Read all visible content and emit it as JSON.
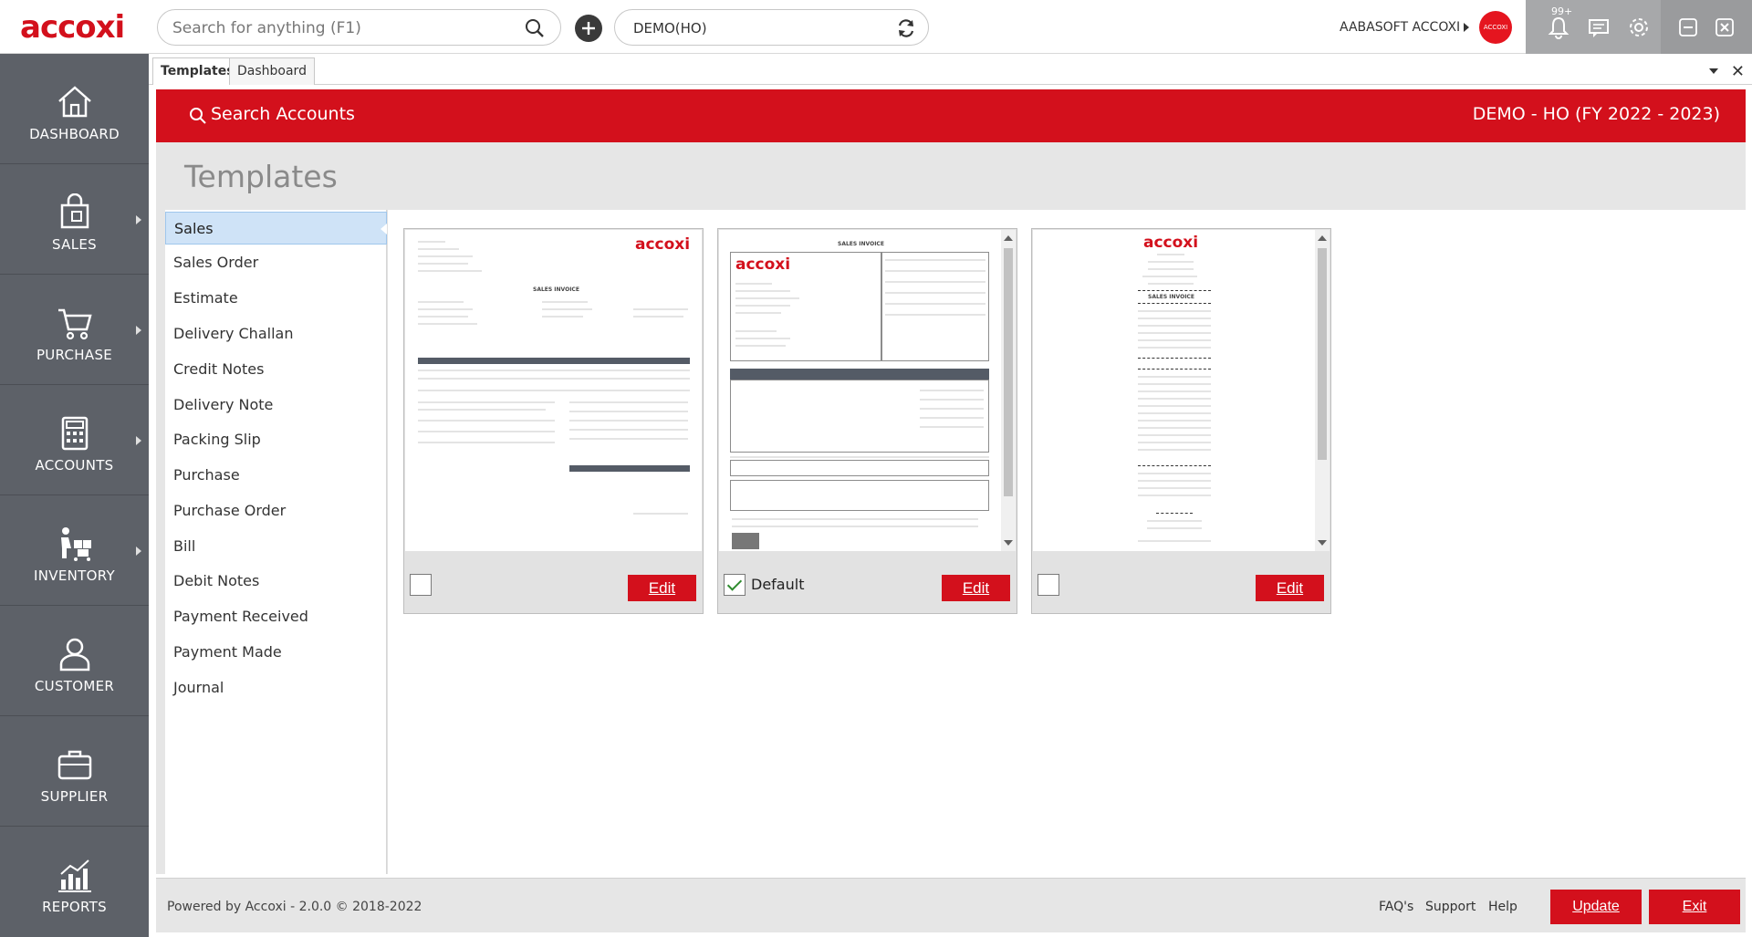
{
  "app": {
    "logo": "accoxi"
  },
  "search": {
    "placeholder": "Search for anything (F1)"
  },
  "company_selector": {
    "value": "DEMO(HO)"
  },
  "user": {
    "name": "AABASOFT ACCOXI",
    "avatar_text": "ACCOXI"
  },
  "notifications": {
    "badge": "99+"
  },
  "sidebar": {
    "items": [
      {
        "label": "DASHBOARD",
        "icon": "home-icon",
        "submenu": false
      },
      {
        "label": "SALES",
        "icon": "shopping-bag-icon",
        "submenu": true
      },
      {
        "label": "PURCHASE",
        "icon": "cart-icon",
        "submenu": true
      },
      {
        "label": "ACCOUNTS",
        "icon": "calculator-icon",
        "submenu": true
      },
      {
        "label": "INVENTORY",
        "icon": "inventory-icon",
        "submenu": true
      },
      {
        "label": "CUSTOMER",
        "icon": "user-icon",
        "submenu": false
      },
      {
        "label": "SUPPLIER",
        "icon": "briefcase-icon",
        "submenu": false
      },
      {
        "label": "REPORTS",
        "icon": "bar-chart-icon",
        "submenu": false
      }
    ]
  },
  "tabs": [
    {
      "label": "Templates",
      "active": true
    },
    {
      "label": "Dashboard",
      "active": false
    }
  ],
  "header": {
    "search_accounts": "Search Accounts",
    "company_title": "DEMO - HO (FY 2022 - 2023)"
  },
  "page": {
    "title": "Templates"
  },
  "template_types": [
    "Sales",
    "Sales Order",
    "Estimate",
    "Delivery Challan",
    "Credit Notes",
    "Delivery Note",
    "Packing Slip",
    "Purchase",
    "Purchase Order",
    "Bill",
    "Debit Notes",
    "Payment Received",
    "Payment Made",
    "Journal"
  ],
  "selected_type": "Sales",
  "cards": [
    {
      "default": false,
      "default_label": "",
      "edit_label": "Edit",
      "preview": {
        "logo": "accoxi",
        "title": "SALES INVOICE"
      }
    },
    {
      "default": true,
      "default_label": "Default",
      "edit_label": "Edit",
      "preview": {
        "logo": "accoxi",
        "title": "SALES INVOICE"
      }
    },
    {
      "default": false,
      "default_label": "",
      "edit_label": "Edit",
      "preview": {
        "logo": "accoxi",
        "title": "SALES INVOICE"
      }
    }
  ],
  "footer": {
    "powered_by": "Powered by Accoxi - 2.0.0 © 2018-2022",
    "links": [
      "FAQ's",
      "Support",
      "Help"
    ],
    "update_label": "Update",
    "exit_label": "Exit"
  },
  "colors": {
    "brand_red": "#d3101c",
    "sidebar": "#5d6168",
    "selection": "#cfe3f7"
  }
}
